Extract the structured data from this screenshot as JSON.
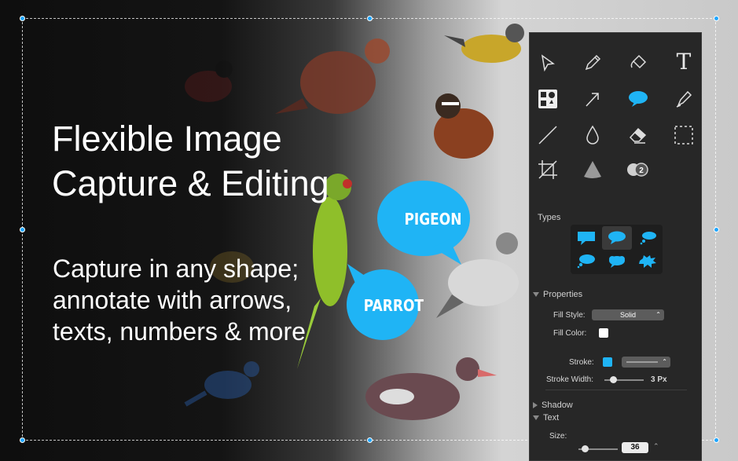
{
  "headline": {
    "line1": "Flexible Image",
    "line2": "Capture & Editing"
  },
  "subline": {
    "line1": "Capture in any shape;",
    "line2": "annotate with arrows,",
    "line3": "texts, numbers & more"
  },
  "bubbles": {
    "pigeon": "PIGEON",
    "parrot": "PARROT"
  },
  "colors": {
    "accent": "#1fb4f5",
    "panel_bg": "#272727",
    "text_white": "#ffffff"
  },
  "panel": {
    "tools": [
      "pointer-icon",
      "pencil-icon",
      "fill-bucket-icon",
      "text-tool-icon",
      "shapes-icon",
      "arrow-icon",
      "speech-bubble-icon",
      "highlighter-icon",
      "line-icon",
      "blur-drop-icon",
      "eraser-icon",
      "marquee-select-icon",
      "crop-icon",
      "spotlight-cone-icon",
      "counter-icon"
    ],
    "text_tool_glyph": "T",
    "counter_number": "2",
    "types_label": "Types",
    "properties_label": "Properties",
    "fill_style_label": "Fill Style:",
    "fill_style_value": "Solid",
    "fill_color_label": "Fill Color:",
    "stroke_label": "Stroke:",
    "stroke_width_label": "Stroke Width:",
    "stroke_width_value": "3 Px",
    "shadow_label": "Shadow",
    "text_label": "Text",
    "size_label": "Size:",
    "size_value": "36",
    "fill_color": "#ffffff",
    "stroke_color": "#1fb4f5"
  }
}
